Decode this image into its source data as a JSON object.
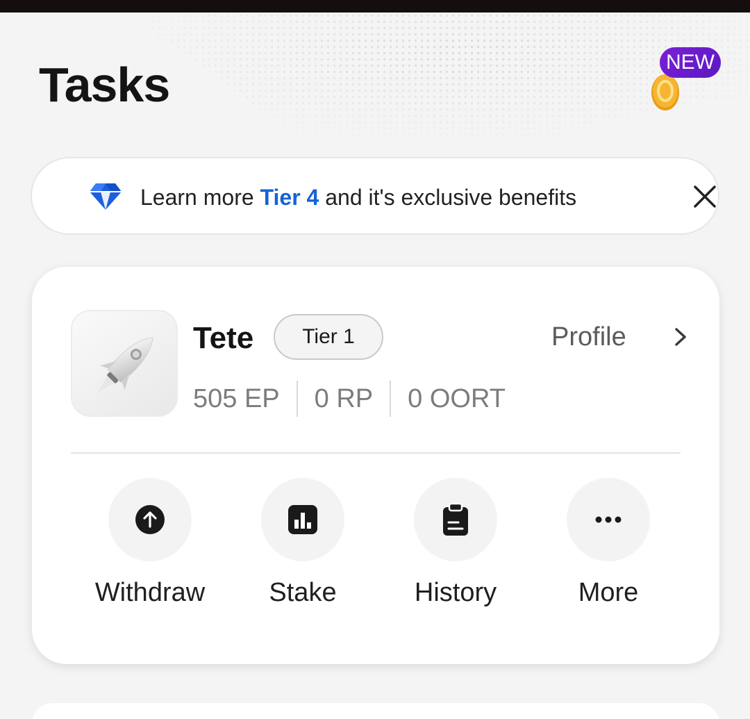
{
  "header": {
    "title": "Tasks",
    "badge_label": "NEW",
    "coin_icon": "gold-coin-icon"
  },
  "banner": {
    "prefix": "Learn more",
    "highlight": "Tier 4",
    "suffix": "and it's exclusive benefits",
    "icon": "diamond-icon",
    "highlight_color": "#1463d6"
  },
  "profile_card": {
    "name": "Tete",
    "tier": "Tier 1",
    "profile_link": "Profile",
    "stats": [
      "505 EP",
      "0 RP",
      "0 OORT"
    ]
  },
  "actions": [
    {
      "label": "Withdraw",
      "icon": "arrow-up-circle-icon"
    },
    {
      "label": "Stake",
      "icon": "bar-chart-icon"
    },
    {
      "label": "History",
      "icon": "clipboard-icon"
    },
    {
      "label": "More",
      "icon": "more-dots-icon"
    }
  ],
  "colors": {
    "accent": "#1463d6",
    "badge": "#6a1ccc",
    "coin": "#f0a91e"
  }
}
